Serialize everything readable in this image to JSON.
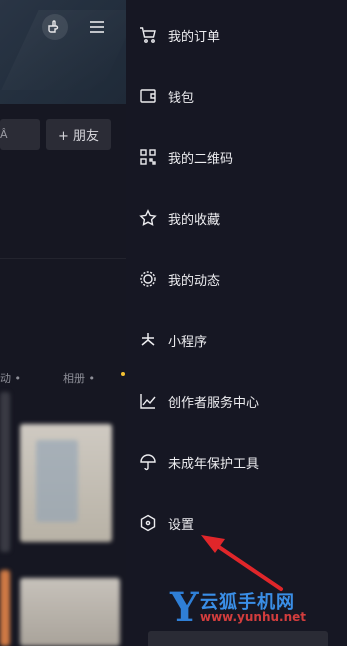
{
  "background": {
    "add_friend_label": "+ 朋友",
    "left_pill_fragment": "Â",
    "tab_left_fragment": "动 •",
    "tab_right_label": "相册 •"
  },
  "drawer": {
    "items": [
      {
        "label": "我的订单",
        "icon": "cart-icon"
      },
      {
        "label": "钱包",
        "icon": "wallet-icon"
      },
      {
        "label": "我的二维码",
        "icon": "qrcode-icon"
      },
      {
        "label": "我的收藏",
        "icon": "star-icon"
      },
      {
        "label": "我的动态",
        "icon": "activity-icon"
      },
      {
        "label": "小程序",
        "icon": "miniprogram-icon"
      },
      {
        "label": "创作者服务中心",
        "icon": "chart-icon"
      },
      {
        "label": "未成年保护工具",
        "icon": "umbrella-icon"
      },
      {
        "label": "设置",
        "icon": "settings-icon"
      }
    ]
  },
  "watermark": {
    "letter": "Y",
    "title": "云狐手机网",
    "url": "www.yunhu.net"
  },
  "colors": {
    "drawer_bg": "#161723",
    "text": "#ededf0",
    "arrow": "#e0262a",
    "watermark_blue": "#3a8ee6",
    "watermark_red": "#d23d3d"
  }
}
